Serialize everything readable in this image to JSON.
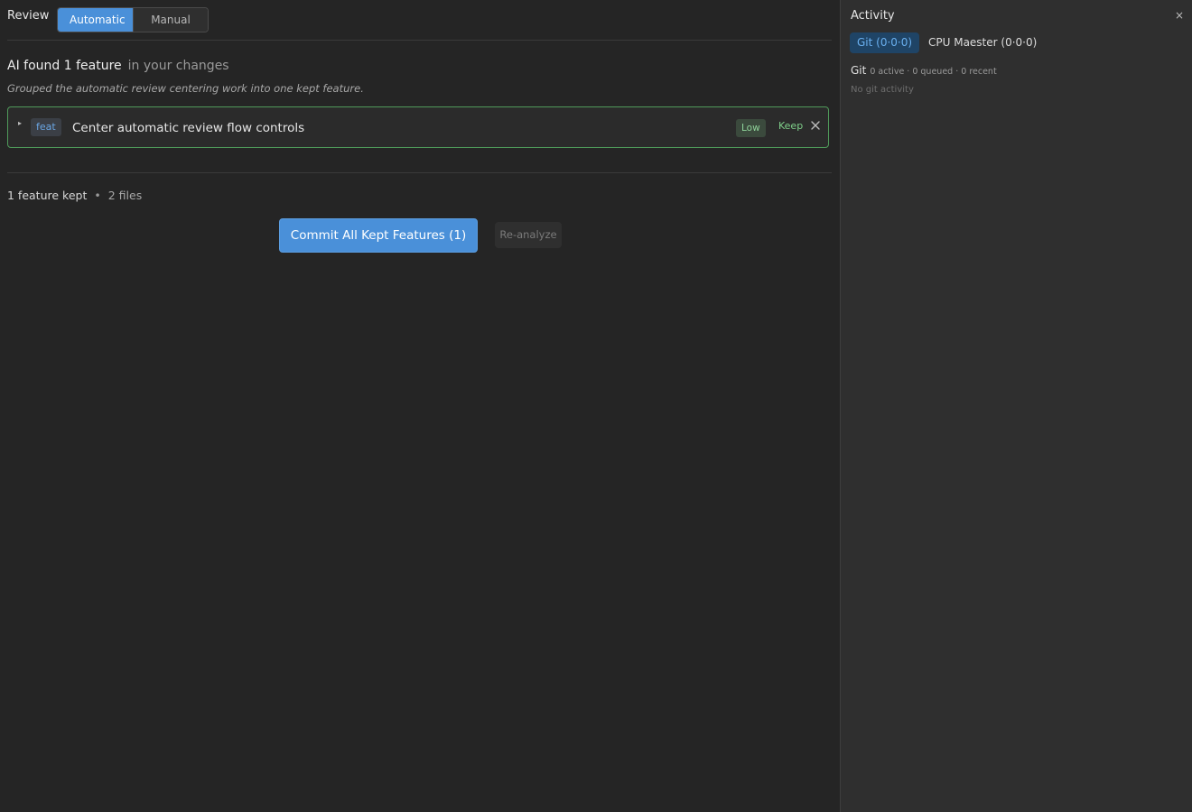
{
  "review": {
    "title": "Review",
    "modes": [
      {
        "label": "Automatic",
        "active": true
      },
      {
        "label": "Manual",
        "active": false
      }
    ],
    "found_strong": "AI found 1 feature",
    "found_rest": "in your changes",
    "summary": "Grouped the automatic review centering work into one kept feature.",
    "features": [
      {
        "type": "feat",
        "name": "Center automatic review flow controls",
        "risk": "Low",
        "action": "Keep"
      }
    ],
    "kept_count_text": "1 feature kept",
    "separator": "•",
    "files_text": "2 files",
    "commit_label": "Commit All Kept Features (1)",
    "reanalyze_label": "Re-analyze"
  },
  "activity": {
    "title": "Activity",
    "close_glyph": "×",
    "tabs": [
      {
        "label": "Git (0·0·0)",
        "active": true
      },
      {
        "label": "CPU Maester (0·0·0)",
        "active": false
      }
    ],
    "git_label": "Git",
    "git_counts": "0 active · 0 queued · 0 recent",
    "empty_text": "No git activity"
  },
  "colors": {
    "accent": "#4a90d9",
    "kept_border": "#4f9a5a",
    "background": "#252525",
    "panel": "#2f2f2f"
  },
  "icons": {
    "expand": "triangle-right-icon",
    "dismiss": "close-icon"
  }
}
